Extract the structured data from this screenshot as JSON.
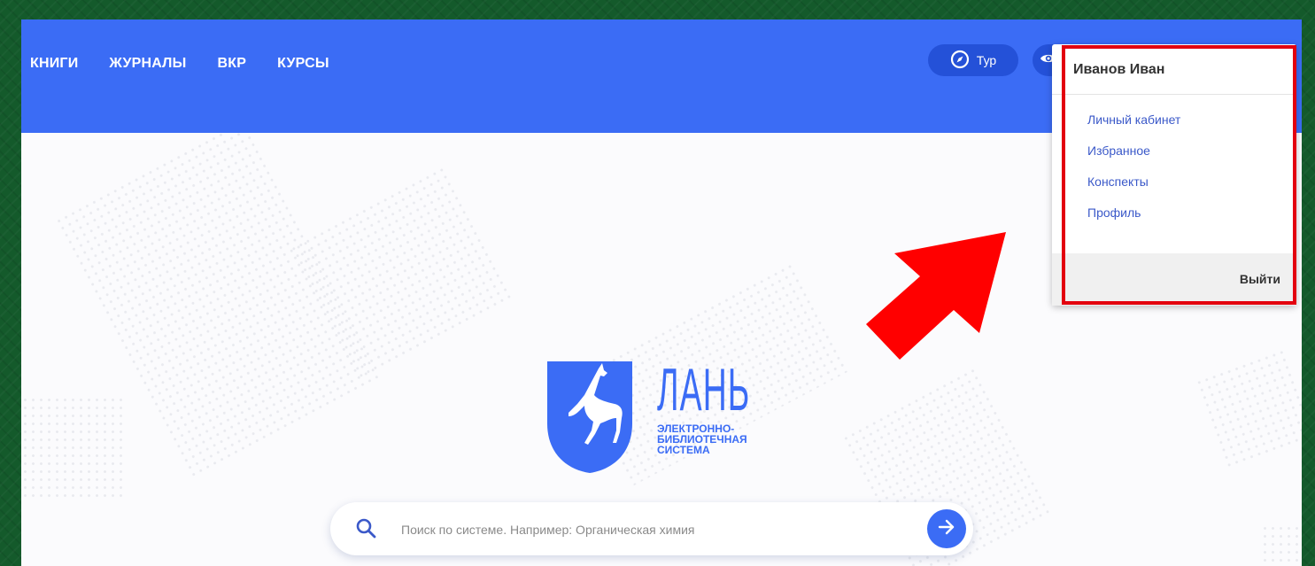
{
  "nav": {
    "items": [
      "КНИГИ",
      "ЖУРНАЛЫ",
      "ВКР",
      "КУРСЫ"
    ]
  },
  "topbar": {
    "tour_label": "Тур",
    "tour_icon": "compass-icon",
    "accessibility_icon": "eye-icon"
  },
  "user_menu": {
    "user_name": "Иванов Иван",
    "items": [
      "Личный кабинет",
      "Избранное",
      "Конспекты",
      "Профиль"
    ],
    "logout_label": "Выйти"
  },
  "logo": {
    "brand": "ЛАНЬ",
    "subtitle_lines": [
      "ЭЛЕКТРОННО-",
      "БИБЛИОТЕЧНАЯ",
      "СИСТЕМА"
    ]
  },
  "search": {
    "placeholder": "Поиск по системе. Например: Органическая химия",
    "value": ""
  },
  "colors": {
    "primary": "#3b6cf5",
    "highlight_red": "#e3000f",
    "frame_green": "#145a2b"
  }
}
